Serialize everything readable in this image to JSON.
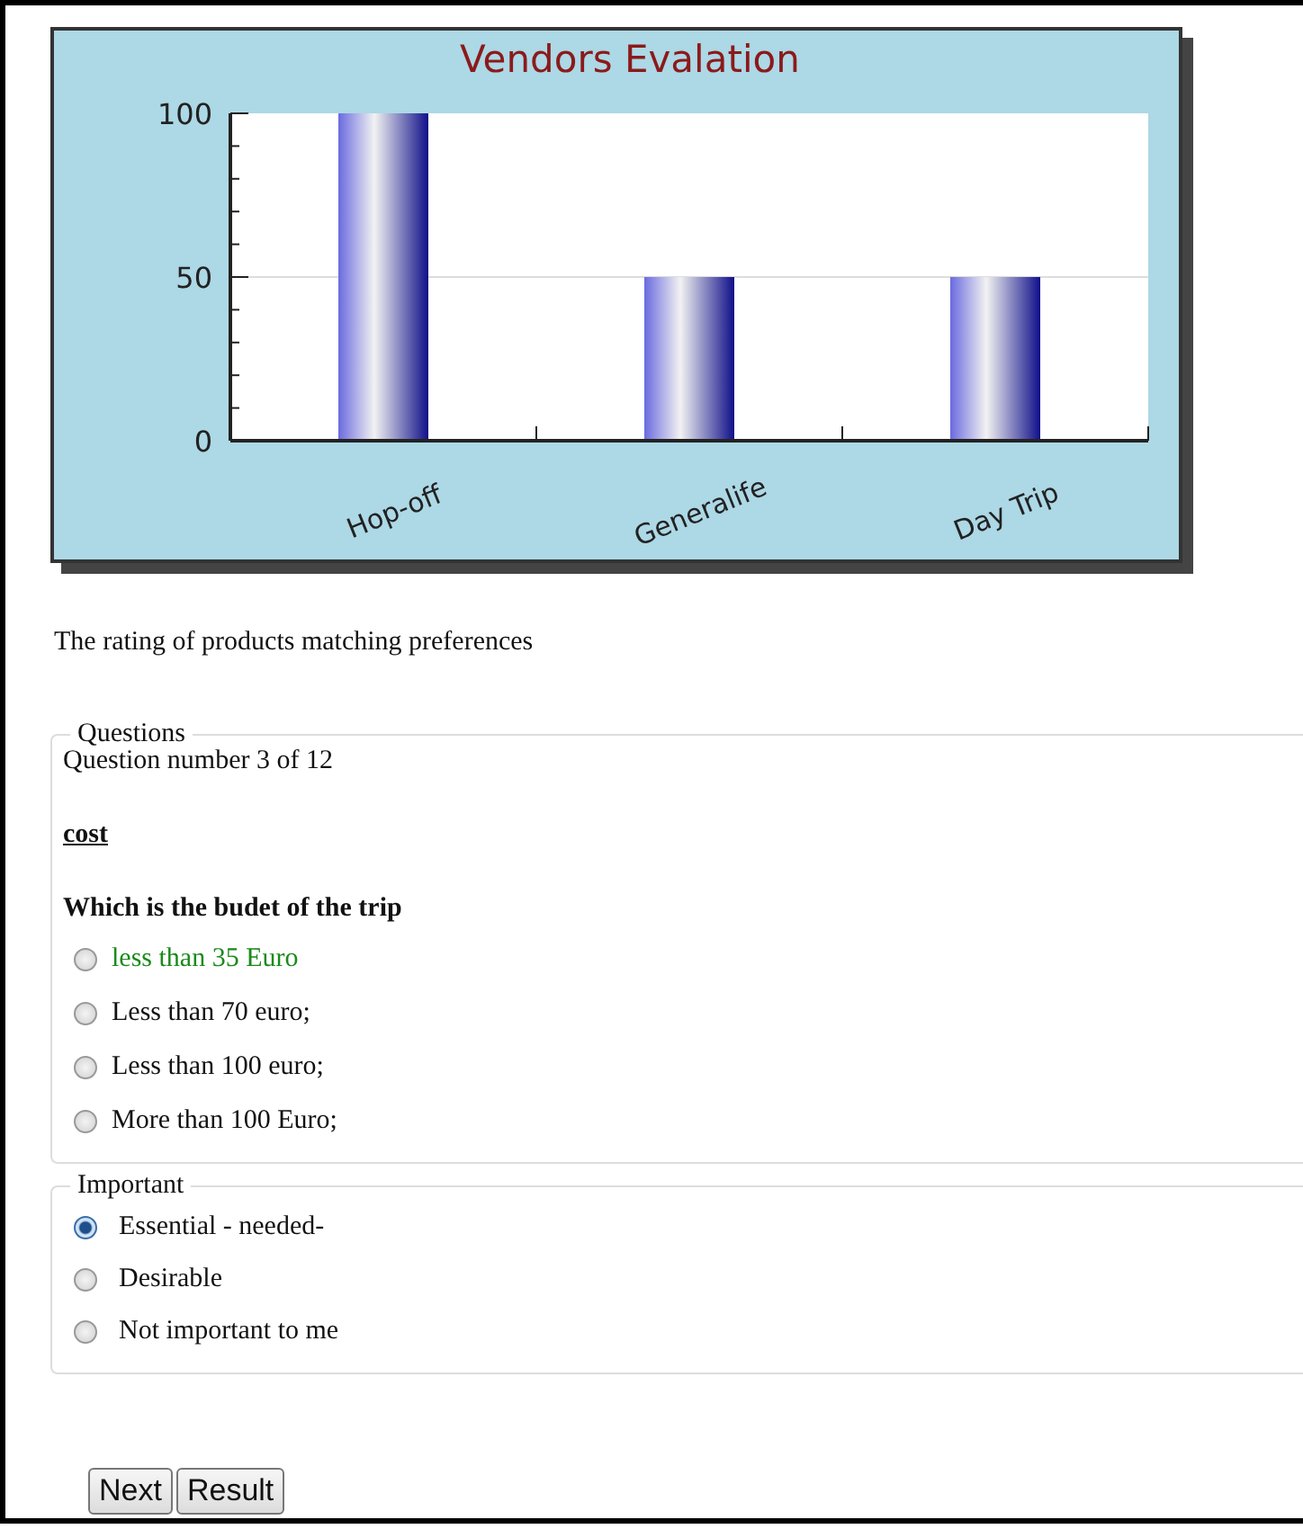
{
  "chart": {
    "chart_data": {
      "type": "bar",
      "title": "Vendors Evalation",
      "categories": [
        "Hop-off",
        "Generalife",
        "Day Trip"
      ],
      "values": [
        100,
        50,
        50
      ],
      "ylim": [
        0,
        100
      ],
      "yticks": [
        0,
        50,
        100
      ]
    }
  },
  "caption": "The rating of products matching preferences",
  "questions": {
    "legend": "Questions",
    "counter": "Question number 3 of 12",
    "topic": "cost",
    "question": "Which is the budet of the trip",
    "options": [
      {
        "label": "less than 35 Euro",
        "selected": false,
        "highlighted": true
      },
      {
        "label": "Less than 70 euro;",
        "selected": false,
        "highlighted": false
      },
      {
        "label": "Less than 100 euro;",
        "selected": false,
        "highlighted": false
      },
      {
        "label": "More than 100 Euro;",
        "selected": false,
        "highlighted": false
      }
    ]
  },
  "importance": {
    "legend": "Important",
    "options": [
      {
        "label": "Essential - needed-",
        "selected": true
      },
      {
        "label": "Desirable",
        "selected": false
      },
      {
        "label": "Not important to me",
        "selected": false
      }
    ]
  },
  "buttons": [
    "Next",
    "Result"
  ]
}
